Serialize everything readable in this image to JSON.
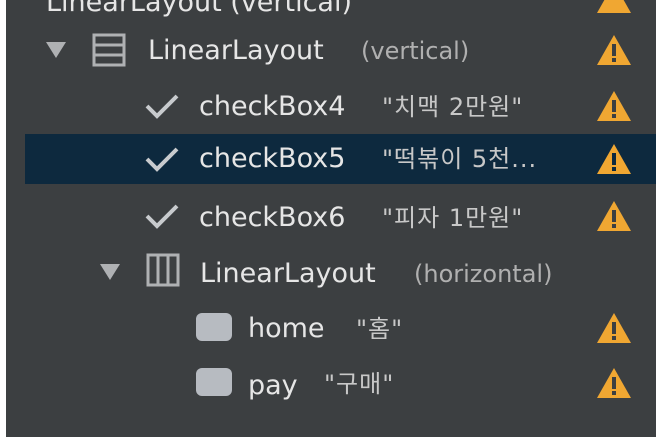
{
  "component_tree": {
    "top_partial_label": "LinearLayout (vertical)",
    "nodes": [
      {
        "name": "LinearLayout",
        "detail": "(vertical)",
        "kind": "layout-vertical",
        "expanded": true,
        "warning": true
      },
      {
        "name": "checkBox4",
        "text": "\"치맥 2만원\"",
        "kind": "checkbox",
        "warning": true
      },
      {
        "name": "checkBox5",
        "text": "\"떡볶이 5천...",
        "kind": "checkbox",
        "warning": true,
        "selected": true
      },
      {
        "name": "checkBox6",
        "text": "\"피자 1만원\"",
        "kind": "checkbox",
        "warning": true
      },
      {
        "name": "LinearLayout",
        "detail": "(horizontal)",
        "kind": "layout-horizontal",
        "expanded": true,
        "warning": false
      },
      {
        "name": "home",
        "text": "\"홈\"",
        "kind": "button",
        "warning": true
      },
      {
        "name": "pay",
        "text": "\"구매\"",
        "kind": "button",
        "warning": true
      }
    ]
  },
  "colors": {
    "panel_bg": "#3c3f41",
    "selected_bg": "#0d293e",
    "warning": "#f0a732",
    "text": "#e6e6e6"
  }
}
